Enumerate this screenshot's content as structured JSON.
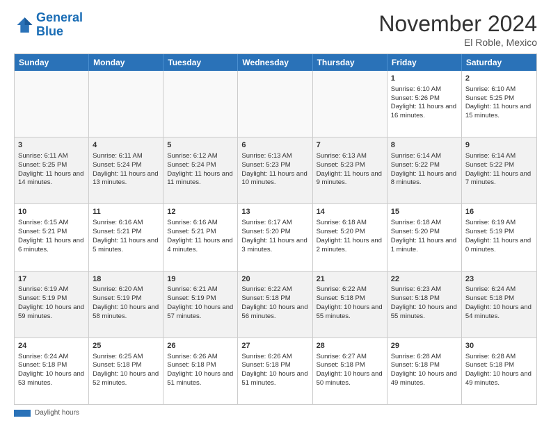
{
  "logo": {
    "line1": "General",
    "line2": "Blue"
  },
  "title": "November 2024",
  "location": "El Roble, Mexico",
  "days_of_week": [
    "Sunday",
    "Monday",
    "Tuesday",
    "Wednesday",
    "Thursday",
    "Friday",
    "Saturday"
  ],
  "footer": {
    "label": "Daylight hours"
  },
  "weeks": [
    [
      {
        "day": "",
        "empty": true
      },
      {
        "day": "",
        "empty": true
      },
      {
        "day": "",
        "empty": true
      },
      {
        "day": "",
        "empty": true
      },
      {
        "day": "",
        "empty": true
      },
      {
        "day": "1",
        "sunrise": "Sunrise: 6:10 AM",
        "sunset": "Sunset: 5:26 PM",
        "daylight": "Daylight: 11 hours and 16 minutes."
      },
      {
        "day": "2",
        "sunrise": "Sunrise: 6:10 AM",
        "sunset": "Sunset: 5:25 PM",
        "daylight": "Daylight: 11 hours and 15 minutes."
      }
    ],
    [
      {
        "day": "3",
        "sunrise": "Sunrise: 6:11 AM",
        "sunset": "Sunset: 5:25 PM",
        "daylight": "Daylight: 11 hours and 14 minutes."
      },
      {
        "day": "4",
        "sunrise": "Sunrise: 6:11 AM",
        "sunset": "Sunset: 5:24 PM",
        "daylight": "Daylight: 11 hours and 13 minutes."
      },
      {
        "day": "5",
        "sunrise": "Sunrise: 6:12 AM",
        "sunset": "Sunset: 5:24 PM",
        "daylight": "Daylight: 11 hours and 11 minutes."
      },
      {
        "day": "6",
        "sunrise": "Sunrise: 6:13 AM",
        "sunset": "Sunset: 5:23 PM",
        "daylight": "Daylight: 11 hours and 10 minutes."
      },
      {
        "day": "7",
        "sunrise": "Sunrise: 6:13 AM",
        "sunset": "Sunset: 5:23 PM",
        "daylight": "Daylight: 11 hours and 9 minutes."
      },
      {
        "day": "8",
        "sunrise": "Sunrise: 6:14 AM",
        "sunset": "Sunset: 5:22 PM",
        "daylight": "Daylight: 11 hours and 8 minutes."
      },
      {
        "day": "9",
        "sunrise": "Sunrise: 6:14 AM",
        "sunset": "Sunset: 5:22 PM",
        "daylight": "Daylight: 11 hours and 7 minutes."
      }
    ],
    [
      {
        "day": "10",
        "sunrise": "Sunrise: 6:15 AM",
        "sunset": "Sunset: 5:21 PM",
        "daylight": "Daylight: 11 hours and 6 minutes."
      },
      {
        "day": "11",
        "sunrise": "Sunrise: 6:16 AM",
        "sunset": "Sunset: 5:21 PM",
        "daylight": "Daylight: 11 hours and 5 minutes."
      },
      {
        "day": "12",
        "sunrise": "Sunrise: 6:16 AM",
        "sunset": "Sunset: 5:21 PM",
        "daylight": "Daylight: 11 hours and 4 minutes."
      },
      {
        "day": "13",
        "sunrise": "Sunrise: 6:17 AM",
        "sunset": "Sunset: 5:20 PM",
        "daylight": "Daylight: 11 hours and 3 minutes."
      },
      {
        "day": "14",
        "sunrise": "Sunrise: 6:18 AM",
        "sunset": "Sunset: 5:20 PM",
        "daylight": "Daylight: 11 hours and 2 minutes."
      },
      {
        "day": "15",
        "sunrise": "Sunrise: 6:18 AM",
        "sunset": "Sunset: 5:20 PM",
        "daylight": "Daylight: 11 hours and 1 minute."
      },
      {
        "day": "16",
        "sunrise": "Sunrise: 6:19 AM",
        "sunset": "Sunset: 5:19 PM",
        "daylight": "Daylight: 11 hours and 0 minutes."
      }
    ],
    [
      {
        "day": "17",
        "sunrise": "Sunrise: 6:19 AM",
        "sunset": "Sunset: 5:19 PM",
        "daylight": "Daylight: 10 hours and 59 minutes."
      },
      {
        "day": "18",
        "sunrise": "Sunrise: 6:20 AM",
        "sunset": "Sunset: 5:19 PM",
        "daylight": "Daylight: 10 hours and 58 minutes."
      },
      {
        "day": "19",
        "sunrise": "Sunrise: 6:21 AM",
        "sunset": "Sunset: 5:19 PM",
        "daylight": "Daylight: 10 hours and 57 minutes."
      },
      {
        "day": "20",
        "sunrise": "Sunrise: 6:22 AM",
        "sunset": "Sunset: 5:18 PM",
        "daylight": "Daylight: 10 hours and 56 minutes."
      },
      {
        "day": "21",
        "sunrise": "Sunrise: 6:22 AM",
        "sunset": "Sunset: 5:18 PM",
        "daylight": "Daylight: 10 hours and 55 minutes."
      },
      {
        "day": "22",
        "sunrise": "Sunrise: 6:23 AM",
        "sunset": "Sunset: 5:18 PM",
        "daylight": "Daylight: 10 hours and 55 minutes."
      },
      {
        "day": "23",
        "sunrise": "Sunrise: 6:24 AM",
        "sunset": "Sunset: 5:18 PM",
        "daylight": "Daylight: 10 hours and 54 minutes."
      }
    ],
    [
      {
        "day": "24",
        "sunrise": "Sunrise: 6:24 AM",
        "sunset": "Sunset: 5:18 PM",
        "daylight": "Daylight: 10 hours and 53 minutes."
      },
      {
        "day": "25",
        "sunrise": "Sunrise: 6:25 AM",
        "sunset": "Sunset: 5:18 PM",
        "daylight": "Daylight: 10 hours and 52 minutes."
      },
      {
        "day": "26",
        "sunrise": "Sunrise: 6:26 AM",
        "sunset": "Sunset: 5:18 PM",
        "daylight": "Daylight: 10 hours and 51 minutes."
      },
      {
        "day": "27",
        "sunrise": "Sunrise: 6:26 AM",
        "sunset": "Sunset: 5:18 PM",
        "daylight": "Daylight: 10 hours and 51 minutes."
      },
      {
        "day": "28",
        "sunrise": "Sunrise: 6:27 AM",
        "sunset": "Sunset: 5:18 PM",
        "daylight": "Daylight: 10 hours and 50 minutes."
      },
      {
        "day": "29",
        "sunrise": "Sunrise: 6:28 AM",
        "sunset": "Sunset: 5:18 PM",
        "daylight": "Daylight: 10 hours and 49 minutes."
      },
      {
        "day": "30",
        "sunrise": "Sunrise: 6:28 AM",
        "sunset": "Sunset: 5:18 PM",
        "daylight": "Daylight: 10 hours and 49 minutes."
      }
    ]
  ]
}
